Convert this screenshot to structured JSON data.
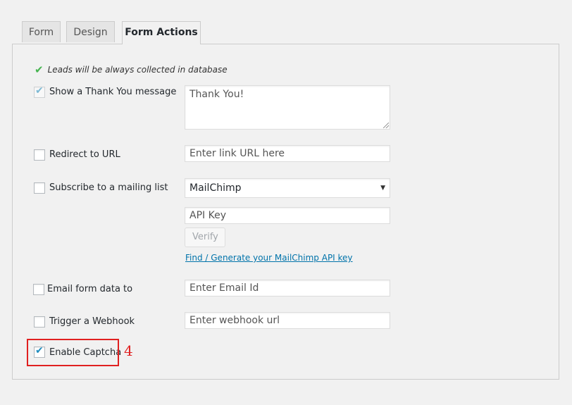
{
  "tabs": [
    {
      "label": "Form"
    },
    {
      "label": "Design"
    },
    {
      "label": "Form Actions"
    }
  ],
  "note": {
    "text": "Leads will be always collected in database",
    "icon": "check-icon"
  },
  "thank_you": {
    "label": "Show a Thank You message",
    "checked": true,
    "value": "Thank You!"
  },
  "redirect": {
    "label": "Redirect to URL",
    "checked": false,
    "placeholder": "Enter link URL here"
  },
  "mailing": {
    "label": "Subscribe to a mailing list",
    "checked": false,
    "provider": "MailChimp",
    "api_key_placeholder": "API Key",
    "verify_label": "Verify",
    "link_text": "Find / Generate your MailChimp API key"
  },
  "email": {
    "label": "Email form data to",
    "checked": false,
    "placeholder": "Enter Email Id"
  },
  "webhook": {
    "label": "Trigger a Webhook",
    "checked": false,
    "placeholder": "Enter webhook url"
  },
  "captcha": {
    "label": "Enable Captcha",
    "checked": true
  },
  "annotation": {
    "number": "4",
    "color": "#e02020"
  },
  "colors": {
    "accent": "#1e8cbe",
    "link": "#0073aa",
    "success": "#46b450"
  }
}
